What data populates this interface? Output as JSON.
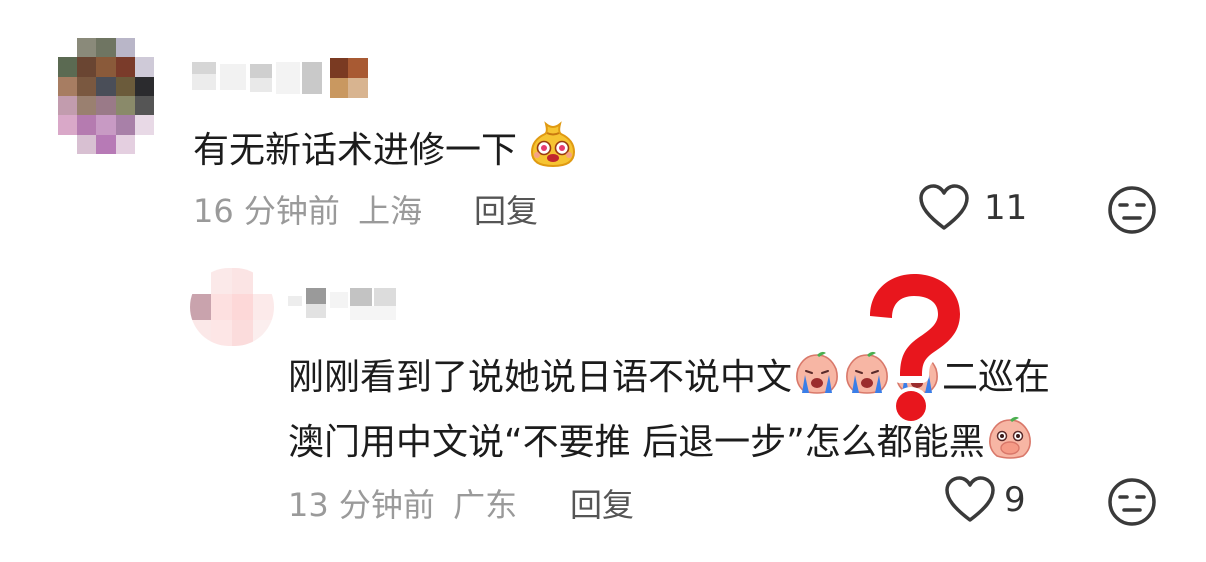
{
  "comments": [
    {
      "text": "有无新话术进修一下",
      "time": "16 分钟前",
      "location": "上海",
      "reply_label": "回复",
      "likes": "11",
      "emoji": "excited-bag-emoji"
    },
    {
      "text_line1": "刚刚看到了说她说日语不说中文",
      "text_line1_tail": "二巡在",
      "text_line2": "澳门用中文说“不要推 后退一步”",
      "text_line2_tail": "怎么都能黑",
      "time": "13 分钟前",
      "location": "广东",
      "reply_label": "回复",
      "likes": "9",
      "emojis": [
        "crying-peach-emoji",
        "crying-peach-emoji",
        "crying-peach-emoji",
        "covering-mouth-peach-emoji"
      ]
    }
  ],
  "overlay": {
    "icon": "red-question-mark-icon"
  },
  "colors": {
    "meta_gray": "#9a9a9a",
    "question_red": "#e8161d"
  }
}
